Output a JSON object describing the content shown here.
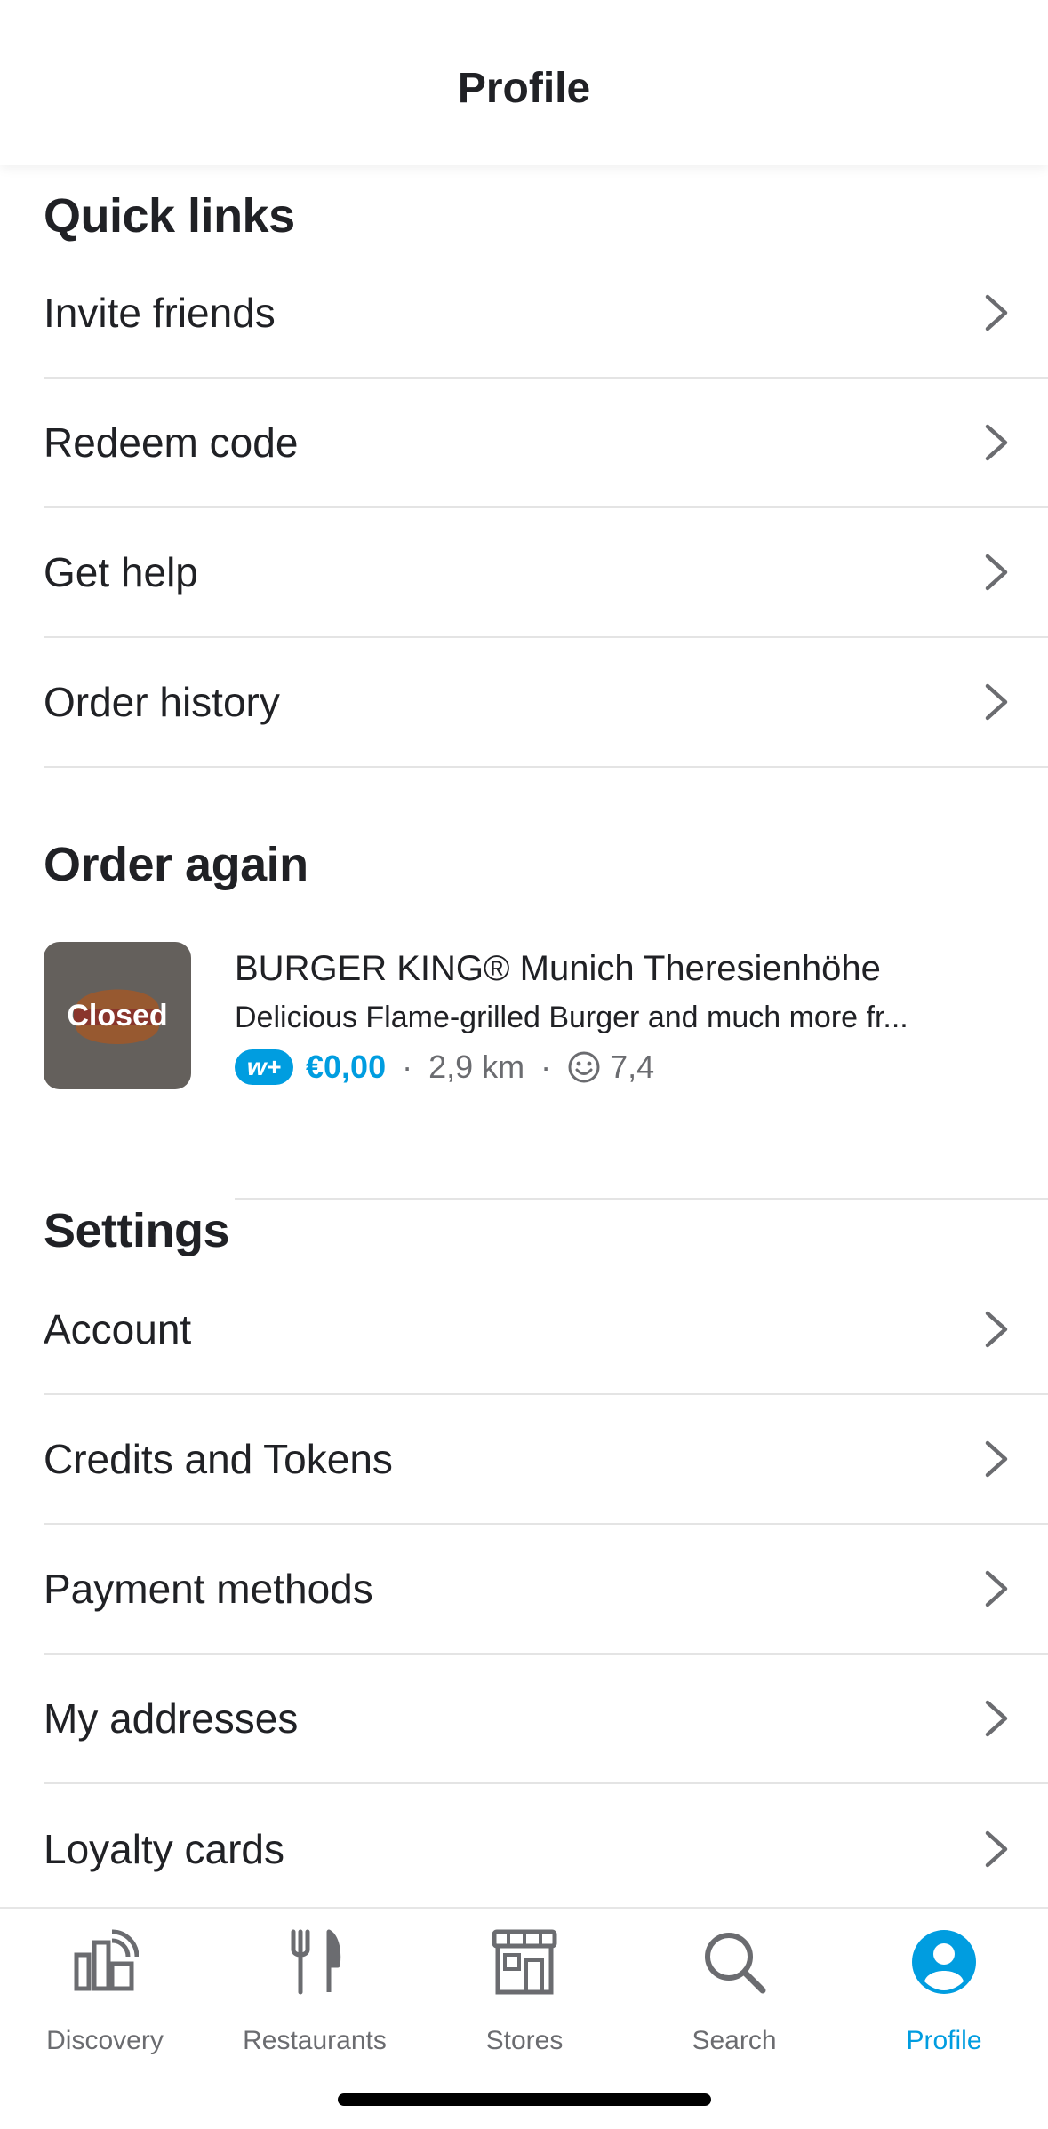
{
  "header": {
    "title": "Profile"
  },
  "quick_links": {
    "title": "Quick links",
    "items": [
      {
        "label": "Invite friends"
      },
      {
        "label": "Redeem code"
      },
      {
        "label": "Get help"
      },
      {
        "label": "Order history"
      }
    ]
  },
  "order_again": {
    "title": "Order again",
    "store": {
      "name": "BURGER KING® Munich Theresienhöhe",
      "description": "Delicious Flame-grilled Burger and much more fr...",
      "status": "Closed",
      "badge": "w+",
      "delivery_fee": "€0,00",
      "distance": "2,9 km",
      "rating": "7,4",
      "separator": "·"
    }
  },
  "settings": {
    "title": "Settings",
    "items": [
      {
        "label": "Account"
      },
      {
        "label": "Credits and Tokens"
      },
      {
        "label": "Payment methods"
      },
      {
        "label": "My addresses"
      },
      {
        "label": "Loyalty cards"
      }
    ]
  },
  "tabbar": {
    "items": [
      {
        "label": "Discovery",
        "icon": "discovery-icon"
      },
      {
        "label": "Restaurants",
        "icon": "restaurants-icon"
      },
      {
        "label": "Stores",
        "icon": "stores-icon"
      },
      {
        "label": "Search",
        "icon": "search-icon"
      },
      {
        "label": "Profile",
        "icon": "profile-icon",
        "active": true
      }
    ]
  },
  "colors": {
    "accent": "#009de0",
    "text": "#202125",
    "muted": "#6b6c70",
    "divider": "#e4e4e4"
  }
}
